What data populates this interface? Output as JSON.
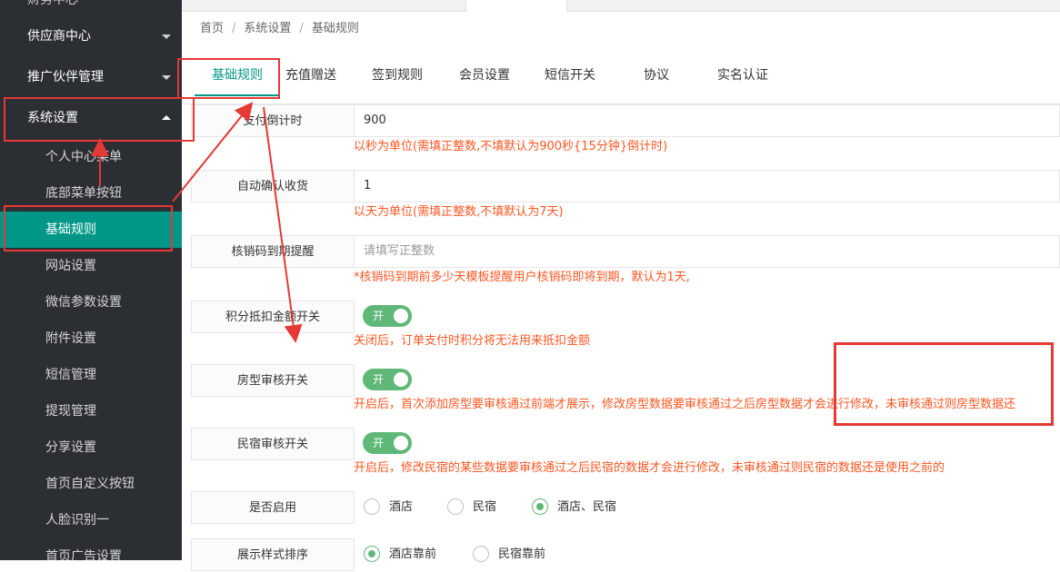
{
  "sidebar": {
    "partial_top": "财务中心",
    "items": [
      {
        "label": "供应商中心"
      },
      {
        "label": "推广伙伴管理"
      },
      {
        "label": "系统设置"
      }
    ],
    "sub_items": [
      {
        "label": "个人中心菜单"
      },
      {
        "label": "底部菜单按钮"
      },
      {
        "label": "基础规则"
      },
      {
        "label": "网站设置"
      },
      {
        "label": "微信参数设置"
      },
      {
        "label": "附件设置"
      },
      {
        "label": "短信管理"
      },
      {
        "label": "提现管理"
      },
      {
        "label": "分享设置"
      },
      {
        "label": "首页自定义按钮"
      },
      {
        "label": "人脸识别一"
      },
      {
        "label": "首页广告设置"
      }
    ]
  },
  "breadcrumb": [
    "首页",
    "系统设置",
    "基础规则"
  ],
  "tabs": [
    {
      "label": "基础规则"
    },
    {
      "label": "充值赠送"
    },
    {
      "label": "签到规则"
    },
    {
      "label": "会员设置"
    },
    {
      "label": "短信开关"
    },
    {
      "label": "协议"
    },
    {
      "label": "实名认证"
    }
  ],
  "form": {
    "pay_countdown": {
      "label": "支付倒计时",
      "value": "900",
      "hint": "以秒为单位(需填正整数,不填默认为900秒{15分钟}倒计时)"
    },
    "auto_confirm": {
      "label": "自动确认收货",
      "value": "1",
      "hint": "以天为单位(需填正整数,不填默认为7天)"
    },
    "verify_remind": {
      "label": "核销码到期提醒",
      "placeholder": "请填写正整数",
      "hint": "*核销码到期前多少天模板提醒用户核销码即将到期，默认为1天,"
    },
    "points_switch": {
      "label": "积分抵扣金额开关",
      "switch_text": "开",
      "hint": "关闭后，订单支付时积分将无法用来抵扣金额"
    },
    "room_review": {
      "label": "房型审核开关",
      "switch_text": "开",
      "hint": "开启后，首次添加房型要审核通过前端才展示，修改房型数据要审核通过之后房型数据才会进行修改，未审核通过则房型数据还"
    },
    "homestay_review": {
      "label": "民宿审核开关",
      "switch_text": "开",
      "hint": "开启后，修改民宿的某些数据要审核通过之后民宿的数据才会进行修改，未审核通过则民宿的数据还是使用之前的"
    },
    "enable": {
      "label": "是否启用",
      "options": [
        "酒店",
        "民宿",
        "酒店、民宿"
      ],
      "selected": "酒店、民宿"
    },
    "display_order": {
      "label": "展示样式排序",
      "options": [
        "酒店靠前",
        "民宿靠前"
      ],
      "selected": "酒店靠前"
    }
  },
  "colors": {
    "sidebar_bg": "#2b2e33",
    "accent": "#009688",
    "switch_on": "#5fb878",
    "hint": "#ff5722",
    "annotation": "#e53935"
  }
}
